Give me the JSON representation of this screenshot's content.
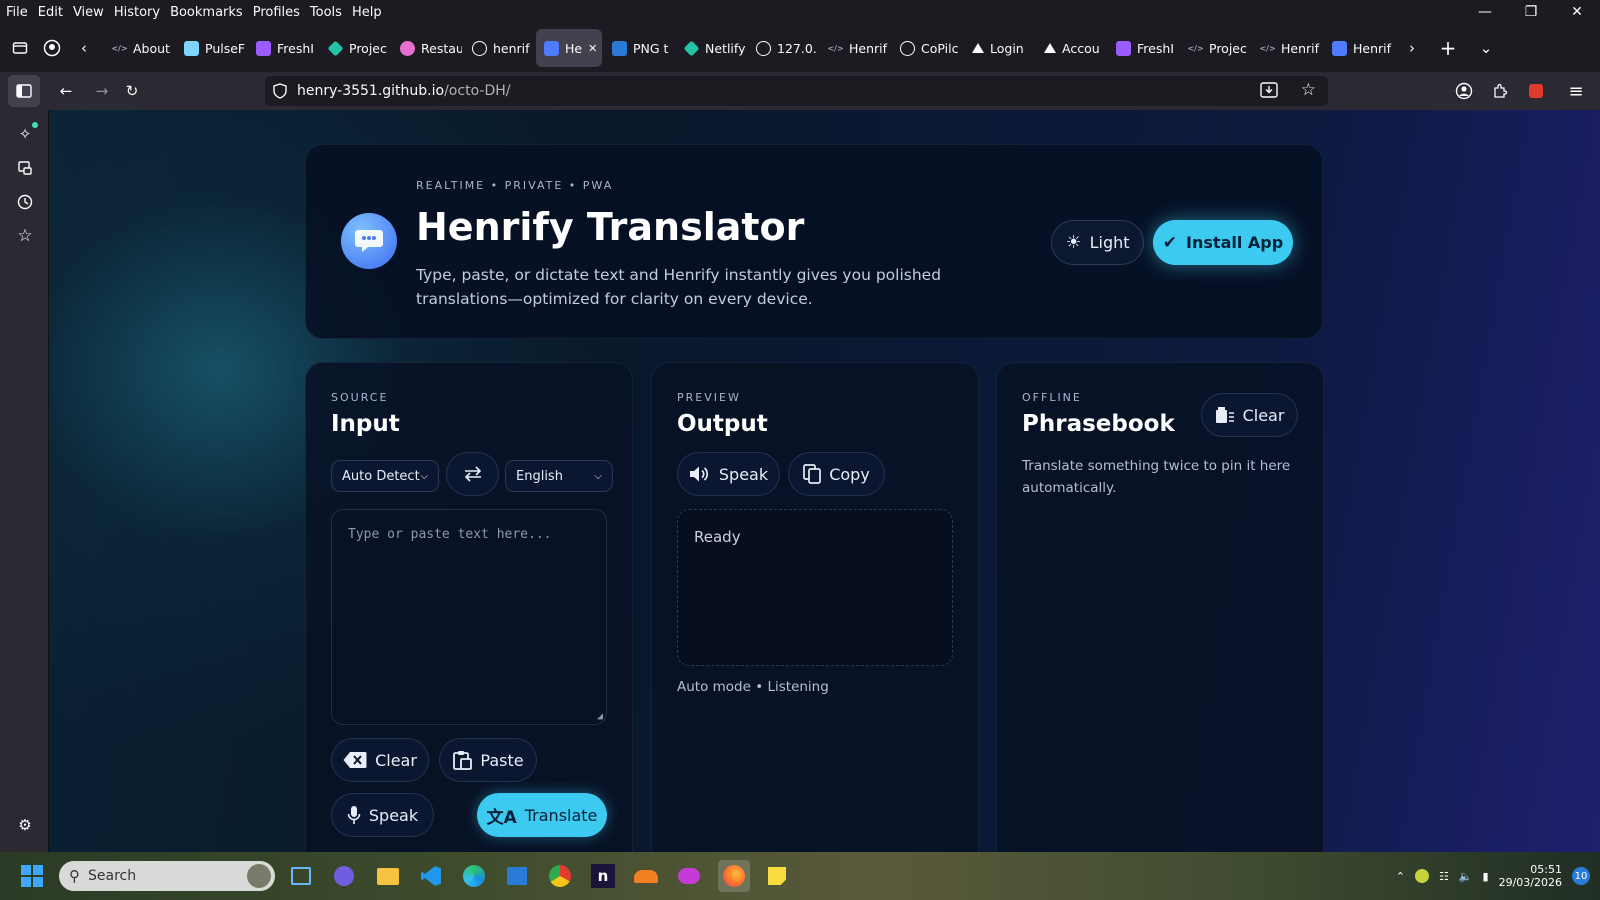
{
  "menubar": {
    "items": [
      "File",
      "Edit",
      "View",
      "History",
      "Bookmarks",
      "Profiles",
      "Tools",
      "Help"
    ]
  },
  "tabs": [
    {
      "label": "About",
      "icon": "code-icon",
      "color": "#9aa3b5",
      "active": false
    },
    {
      "label": "PulseF",
      "icon": "pulse-icon",
      "color": "#7fd4ff",
      "active": false
    },
    {
      "label": "FreshI",
      "icon": "bolt-icon",
      "color": "#9b5cff",
      "active": false
    },
    {
      "label": "Projec",
      "icon": "diamond-icon",
      "color": "#22c3a6",
      "active": false
    },
    {
      "label": "Restau",
      "icon": "circle-icon",
      "color": "#e66fd0",
      "active": false
    },
    {
      "label": "henrif",
      "icon": "google-icon",
      "color": "#ffffff",
      "active": false
    },
    {
      "label": "He",
      "icon": "translate-icon",
      "color": "#4f7cff",
      "active": true
    },
    {
      "label": "PNG t",
      "icon": "f-icon",
      "color": "#2a7bd8",
      "active": false
    },
    {
      "label": "Netlify",
      "icon": "diamond-icon",
      "color": "#22c3a6",
      "active": false
    },
    {
      "label": "127.0.",
      "icon": "info-icon",
      "color": "#fbfbfe",
      "active": false
    },
    {
      "label": "Henrif",
      "icon": "code-icon",
      "color": "#9aa3b5",
      "active": false
    },
    {
      "label": "CoPilc",
      "icon": "github-icon",
      "color": "#fbfbfe",
      "active": false
    },
    {
      "label": "Login",
      "icon": "triangle-icon",
      "color": "#fbfbfe",
      "active": false
    },
    {
      "label": "Accou",
      "icon": "triangle-icon",
      "color": "#fbfbfe",
      "active": false
    },
    {
      "label": "FreshI",
      "icon": "bolt-icon",
      "color": "#9b5cff",
      "active": false
    },
    {
      "label": "Projec",
      "icon": "code-icon",
      "color": "#9aa3b5",
      "active": false
    },
    {
      "label": "Henrif",
      "icon": "code-icon",
      "color": "#9aa3b5",
      "active": false
    },
    {
      "label": "Henrif",
      "icon": "translate-icon",
      "color": "#4f7cff",
      "active": false
    }
  ],
  "url": {
    "host": "henry-3551.github.io",
    "path": "/octo-DH/"
  },
  "hero": {
    "eyebrow": "REALTIME • PRIVATE • PWA",
    "title": "Henrify Translator",
    "description": "Type, paste, or dictate text and Henrify instantly gives you polished translations—optimized for clarity on every device.",
    "light_label": "Light",
    "install_label": "Install App"
  },
  "input_panel": {
    "eyebrow": "SOURCE",
    "title": "Input",
    "source_lang": "Auto Detect",
    "target_lang": "English",
    "placeholder": "Type or paste text here...",
    "clear_label": "Clear",
    "paste_label": "Paste",
    "speak_label": "Speak",
    "translate_label": "Translate"
  },
  "output_panel": {
    "eyebrow": "PREVIEW",
    "title": "Output",
    "speak_label": "Speak",
    "copy_label": "Copy",
    "output_text": "Ready",
    "status": "Auto mode • Listening"
  },
  "phrasebook_panel": {
    "eyebrow": "OFFLINE",
    "title": "Phrasebook",
    "clear_label": "Clear",
    "description": "Translate something twice to pin it here automatically."
  },
  "taskbar": {
    "search_label": "Search",
    "time": "05:51",
    "date": "29/03/2026",
    "notifications": "10"
  },
  "colors": {
    "accent": "#3ccaf0",
    "page_dark": "#081729",
    "brand_blue": "#3c6cf0"
  }
}
